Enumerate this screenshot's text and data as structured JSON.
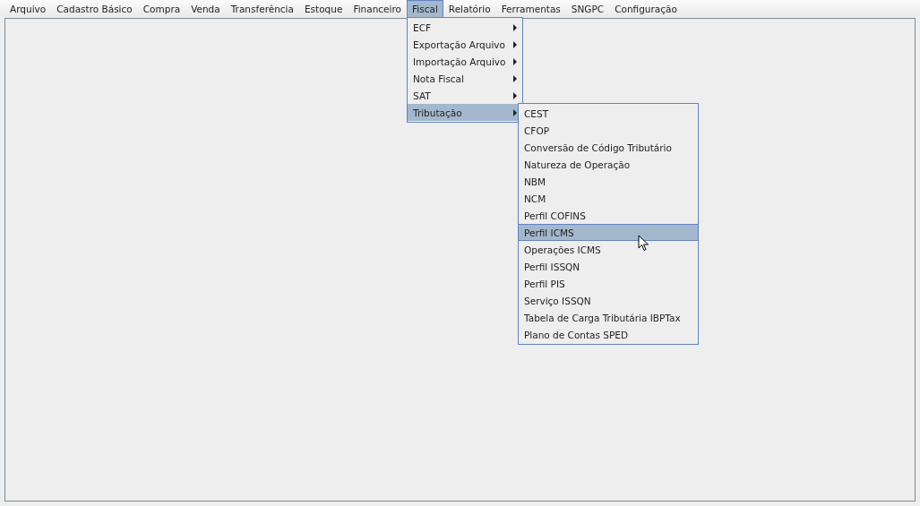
{
  "menubar": [
    {
      "label": "Arquivo",
      "selected": false
    },
    {
      "label": "Cadastro Básico",
      "selected": false
    },
    {
      "label": "Compra",
      "selected": false
    },
    {
      "label": "Venda",
      "selected": false
    },
    {
      "label": "Transferência",
      "selected": false
    },
    {
      "label": "Estoque",
      "selected": false
    },
    {
      "label": "Financeiro",
      "selected": false
    },
    {
      "label": "Fiscal",
      "selected": true,
      "children": [
        {
          "label": "ECF",
          "kind": "submenu",
          "selected": false
        },
        {
          "label": "Exportação Arquivo",
          "kind": "submenu",
          "selected": false
        },
        {
          "label": "Importação Arquivo",
          "kind": "submenu",
          "selected": false
        },
        {
          "label": "Nota Fiscal",
          "kind": "submenu",
          "selected": false
        },
        {
          "label": "SAT",
          "kind": "submenu",
          "selected": false
        },
        {
          "label": "Tributação",
          "kind": "submenu",
          "selected": true,
          "children": [
            {
              "label": "CEST",
              "selected": false
            },
            {
              "label": "CFOP",
              "selected": false
            },
            {
              "label": "Conversão de Código Tributário",
              "selected": false
            },
            {
              "label": "Natureza de Operação",
              "selected": false
            },
            {
              "label": "NBM",
              "selected": false
            },
            {
              "label": "NCM",
              "selected": false
            },
            {
              "label": "Perfil COFINS",
              "selected": false
            },
            {
              "label": "Perfil ICMS",
              "selected": true
            },
            {
              "label": "Operações ICMS",
              "selected": false
            },
            {
              "label": "Perfil ISSQN",
              "selected": false
            },
            {
              "label": "Perfil PIS",
              "selected": false
            },
            {
              "label": "Serviço ISSQN",
              "selected": false
            },
            {
              "label": "Tabela de Carga Tributária IBPTax",
              "selected": false
            },
            {
              "label": "Plano de Contas SPED",
              "selected": false
            }
          ]
        }
      ]
    },
    {
      "label": "Relatório",
      "selected": false
    },
    {
      "label": "Ferramentas",
      "selected": false
    },
    {
      "label": "SNGPC",
      "selected": false
    },
    {
      "label": "Configuração",
      "selected": false
    }
  ]
}
